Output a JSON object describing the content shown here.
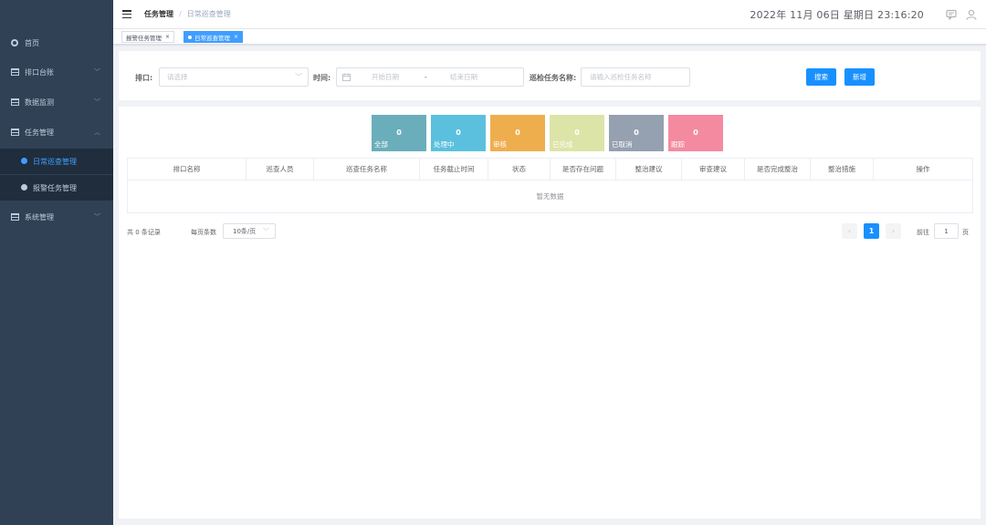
{
  "sidebar": {
    "items": [
      {
        "label": "首页",
        "icon": "home-icon"
      },
      {
        "label": "排口台账",
        "icon": "table-icon"
      },
      {
        "label": "数据监测",
        "icon": "table-icon"
      },
      {
        "label": "任务管理",
        "icon": "table-icon"
      },
      {
        "label": "系统管理",
        "icon": "table-icon"
      }
    ],
    "sub_items": [
      {
        "label": "日常巡查管理",
        "active": true
      },
      {
        "label": "报警任务管理",
        "active": false
      }
    ]
  },
  "header": {
    "breadcrumb_first": "任务管理",
    "breadcrumb_sep": "/",
    "breadcrumb_last": "日常巡查管理",
    "datetime": "2022年 11月 06日 星期日 23:16:20"
  },
  "tags": [
    {
      "label": "报警任务管理",
      "close": "×"
    },
    {
      "label": "日常巡查管理",
      "close": "×"
    }
  ],
  "search": {
    "outlet_label": "排口:",
    "outlet_placeholder": "请选择",
    "time_label": "时间:",
    "date_start_placeholder": "开始日期",
    "date_sep": "-",
    "date_end_placeholder": "结束日期",
    "task_name_label": "巡检任务名称:",
    "task_name_placeholder": "请输入巡检任务名称",
    "search_button": "搜索",
    "add_button": "新增"
  },
  "stats": [
    {
      "label": "全部",
      "value": "0",
      "color": "#6aaebb"
    },
    {
      "label": "处理中",
      "value": "0",
      "color": "#5bc0de"
    },
    {
      "label": "审核",
      "value": "0",
      "color": "#efae4e"
    },
    {
      "label": "已完成",
      "value": "0",
      "color": "#dde4a8"
    },
    {
      "label": "已取消",
      "value": "0",
      "color": "#95a0b0"
    },
    {
      "label": "跟踪",
      "value": "0",
      "color": "#f48aa0"
    }
  ],
  "table": {
    "columns": [
      "排口名称",
      "巡查人员",
      "巡查任务名称",
      "任务截止时间",
      "状态",
      "是否存在问题",
      "整治建议",
      "审查建议",
      "是否完成整治",
      "整治措施",
      "操作"
    ],
    "empty_text": "暂无数据"
  },
  "pagination": {
    "total": "共 0 条记录",
    "page_size_label": "每页条数",
    "page_size": "10条/页",
    "prev": "‹",
    "current_page": "1",
    "next": "›",
    "goto_label": "前往",
    "goto_value": "1",
    "goto_suffix": "页"
  },
  "colors": {
    "sidebar_bg": "#304156",
    "accent": "#1890ff",
    "active_menu": "#409eff"
  }
}
